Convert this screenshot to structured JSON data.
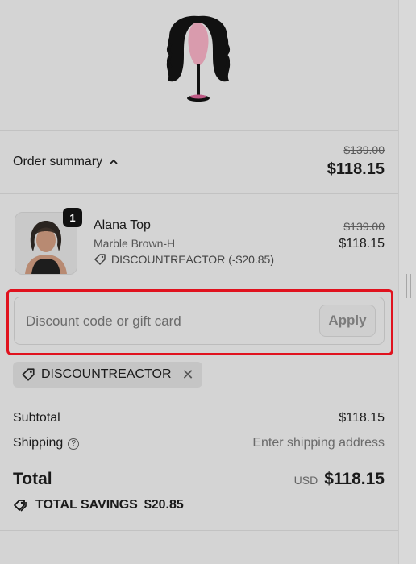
{
  "logo": {
    "icon": "wig-mannequin-logo"
  },
  "order_summary": {
    "label": "Order summary",
    "toggle_icon": "chevron-up-icon",
    "original_total": "$139.00",
    "total": "$118.15"
  },
  "line_item": {
    "quantity": "1",
    "name": "Alana Top",
    "variant": "Marble Brown-H",
    "discount": "DISCOUNTREACTOR (-$20.85)",
    "original_price": "$139.00",
    "price": "$118.15"
  },
  "discount_form": {
    "placeholder": "Discount code or gift card",
    "apply_label": "Apply"
  },
  "applied_code": {
    "code": "DISCOUNTREACTOR",
    "remove_icon": "close-icon"
  },
  "subtotal": {
    "label": "Subtotal",
    "value": "$118.15"
  },
  "shipping": {
    "label": "Shipping",
    "value": "Enter shipping address"
  },
  "total": {
    "label": "Total",
    "currency": "USD",
    "value": "$118.15"
  },
  "savings": {
    "label": "TOTAL SAVINGS",
    "value": "$20.85"
  },
  "colors": {
    "highlight": "#e0121e",
    "background": "#d4d4d4"
  }
}
